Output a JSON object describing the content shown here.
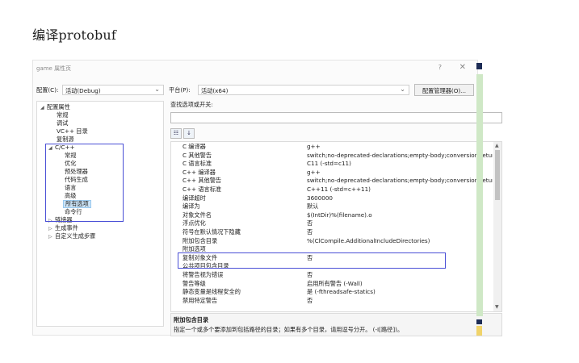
{
  "page_heading": "编译protobuf",
  "dialog": {
    "title": "game 属性页",
    "help": "?",
    "close": "✕"
  },
  "config": {
    "configuration_label": "配置(C):",
    "configuration_value": "活动(Debug)",
    "platform_label": "平台(P):",
    "platform_value": "活动(x64)",
    "manager_button": "配置管理器(O)..."
  },
  "tree": {
    "items": [
      {
        "label": "配置属性",
        "expanded": true
      },
      {
        "label": "常规"
      },
      {
        "label": "调试"
      },
      {
        "label": "VC++ 目录"
      },
      {
        "label": "复制源"
      },
      {
        "label": "C/C++",
        "expanded": true
      },
      {
        "label": "常规"
      },
      {
        "label": "优化"
      },
      {
        "label": "预处理器"
      },
      {
        "label": "代码生成"
      },
      {
        "label": "语言"
      },
      {
        "label": "高级"
      },
      {
        "label": "所有选项",
        "selected": true
      },
      {
        "label": "命令行"
      },
      {
        "label": "链接器",
        "expanded": false
      },
      {
        "label": "生成事件",
        "expanded": false
      },
      {
        "label": "自定义生成步骤",
        "expanded": false
      }
    ]
  },
  "search": {
    "label": "查找选项或开关:",
    "value": ""
  },
  "view_buttons": [
    "categorized",
    "alphabetical"
  ],
  "properties": [
    {
      "name": "C 编译器",
      "value": "g++"
    },
    {
      "name": "C 其他警告",
      "value": "switch;no-deprecated-declarations;empty-body;conversion;return-t"
    },
    {
      "name": "C 语言标准",
      "value": "C11 (-std=c11)"
    },
    {
      "name": "C++ 编译器",
      "value": "g++"
    },
    {
      "name": "C++ 其他警告",
      "value": "switch;no-deprecated-declarations;empty-body;conversion;return-t"
    },
    {
      "name": "C++ 语言标准",
      "value": "C++11 (-std=c++11)"
    },
    {
      "name": "编译超时",
      "value": "3600000"
    },
    {
      "name": "编译为",
      "value": "默认"
    },
    {
      "name": "对象文件名",
      "value": "$(IntDir)%(filename).o"
    },
    {
      "name": "浮点优化",
      "value": "否"
    },
    {
      "name": "符号在默认情况下隐藏",
      "value": "否"
    },
    {
      "name": "附加包含目录",
      "value": "%(ClCompile.AdditionalIncludeDirectories)"
    },
    {
      "name": "附加选项",
      "value": ""
    },
    {
      "name": "复制对象文件",
      "value": "否"
    },
    {
      "name": "公共项目包含目录",
      "value": ""
    },
    {
      "name": "将警告视为错误",
      "value": "否"
    },
    {
      "name": "警告等级",
      "value": "启用所有警告 (-Wall)"
    },
    {
      "name": "静态变量是线程安全的",
      "value": "是 (-fthreadsafe-statics)"
    },
    {
      "name": "禁用特定警告",
      "value": "否"
    }
  ],
  "description": {
    "title": "附加包含目录",
    "text": "指定一个或多个要添加到包括路径的目录；如果有多个目录，请用逗号分开。 (-I[路径])。"
  },
  "colors": {
    "highlight_box": "#4a4fd6",
    "selected_bg": "#cce4f7"
  }
}
